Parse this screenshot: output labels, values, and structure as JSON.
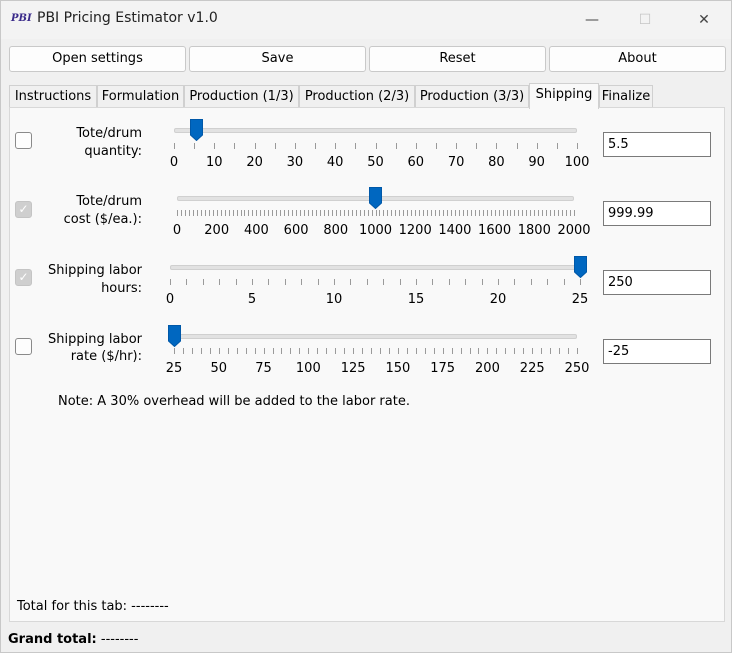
{
  "window": {
    "title": "PBI Pricing Estimator v1.0",
    "icon_text": "PBI",
    "controls": [
      "minimize-icon",
      "maximize-icon",
      "close-icon"
    ]
  },
  "toolbar": {
    "open_settings": "Open settings",
    "save": "Save",
    "reset": "Reset",
    "about": "About"
  },
  "tabs": [
    {
      "label": "Instructions"
    },
    {
      "label": "Formulation"
    },
    {
      "label": "Production (1/3)"
    },
    {
      "label": "Production (2/3)"
    },
    {
      "label": "Production (3/3)"
    },
    {
      "label": "Shipping",
      "active": true
    },
    {
      "label": "Finalize"
    }
  ],
  "rows": [
    {
      "label_line1": "Tote/drum",
      "label_line2": "quantity:",
      "checked": false,
      "min": 0,
      "max": 100,
      "value": 5.5,
      "ticks": [
        "0",
        "10",
        "20",
        "30",
        "40",
        "50",
        "60",
        "70",
        "80",
        "90",
        "100"
      ],
      "minor_ticks": 21,
      "box_value": "5.5"
    },
    {
      "label_line1": "Tote/drum",
      "label_line2": "cost ($/ea.):",
      "checked": true,
      "min": 0,
      "max": 2000,
      "value": 999.99,
      "ticks": [
        "0",
        "200",
        "400",
        "600",
        "800",
        "1000",
        "1200",
        "1400",
        "1600",
        "1800",
        "2000"
      ],
      "minor_ticks": 101,
      "box_value": "999.99"
    },
    {
      "label_line1": "Shipping labor",
      "label_line2": "hours:",
      "checked": true,
      "min": 0,
      "max": 25,
      "value": 25,
      "ticks": [
        "0",
        "5",
        "10",
        "15",
        "20",
        "25"
      ],
      "minor_ticks": 26,
      "box_value": "250"
    },
    {
      "label_line1": "Shipping labor",
      "label_line2": "rate ($/hr):",
      "checked": false,
      "min": 25,
      "max": 250,
      "value": 25,
      "ticks": [
        "25",
        "50",
        "75",
        "100",
        "125",
        "150",
        "175",
        "200",
        "225",
        "250"
      ],
      "minor_ticks": 46,
      "box_value": "-25"
    }
  ],
  "note": "Note: A 30% overhead will be added to the labor rate.",
  "tab_total": "Total for this tab: --------",
  "grand_total": {
    "label": "Grand total:",
    "value": "--------"
  },
  "colors": {
    "accent": "#0067c0",
    "panel": "#f9f9f9",
    "window": "#f0f0f0"
  }
}
